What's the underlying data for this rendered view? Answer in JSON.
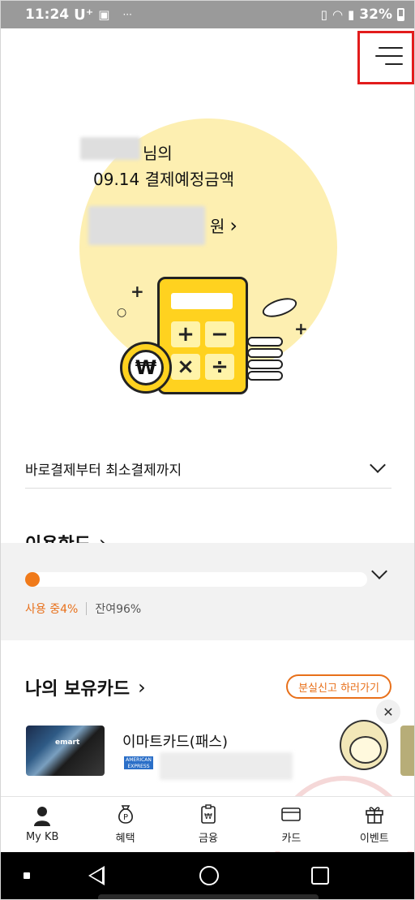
{
  "status_bar": {
    "time": "11:24",
    "carrier": "U⁺",
    "image_icon": "image-icon",
    "more": "···",
    "battery_percent": "32%",
    "icons": [
      "vibrate-icon",
      "wifi-icon",
      "signal-icon",
      "battery-icon"
    ]
  },
  "header": {
    "menu_icon": "hamburger-menu-icon"
  },
  "hero": {
    "name_suffix": "님의",
    "payment_label": "09.14 결제예정금액",
    "amount_unit": "원",
    "amount_chevron": "›"
  },
  "calculator_keys": [
    "+",
    "−",
    "×",
    "÷"
  ],
  "won_symbol": "₩",
  "payment_option": {
    "label": "바로결제부터 최소결제까지"
  },
  "limit": {
    "title": "이용한도",
    "chevron": "›",
    "used_fraction": 0.04,
    "used_label": "사용 중4%",
    "remaining_label": "잔여96%"
  },
  "my_cards": {
    "title": "나의 보유카드",
    "chevron": "›",
    "report_lost_label": "분실신고 하러가기",
    "card_name": "이마트카드(패스)",
    "card_brand_label": "emart",
    "amex_label": "AMERICAN EXPRESS"
  },
  "floating": {
    "close_icon": "close-icon",
    "mascot_icon": "mascot-icon"
  },
  "bottom_nav": [
    {
      "label": "My KB",
      "icon": "person-icon"
    },
    {
      "label": "혜택",
      "icon": "benefit-pouch-icon"
    },
    {
      "label": "금융",
      "icon": "finance-icon"
    },
    {
      "label": "카드",
      "icon": "card-icon"
    },
    {
      "label": "이벤트",
      "icon": "gift-icon"
    }
  ],
  "colors": {
    "accent_orange": "#f07a1a",
    "hero_yellow": "#fdefb1",
    "calc_yellow": "#ffd21f",
    "highlight_red": "#e21c1c"
  }
}
